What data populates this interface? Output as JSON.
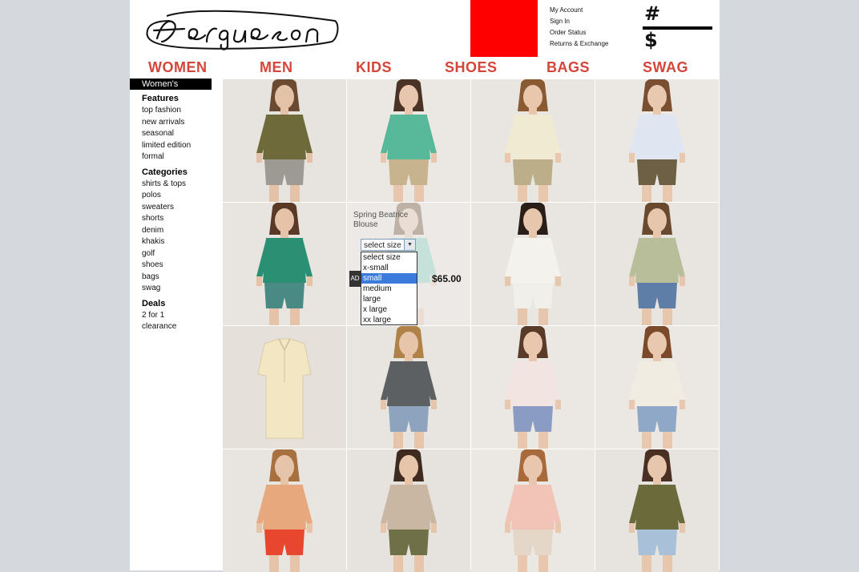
{
  "brand": {
    "logo_text": "Ferguson"
  },
  "account_links": [
    "My Account",
    "Sign In",
    "Order Status",
    "Returns & Exchange"
  ],
  "cart": {
    "count_symbol": "#",
    "total_symbol": "$"
  },
  "nav": [
    "WOMEN",
    "MEN",
    "KIDS",
    "SHOES",
    "BAGS",
    "SWAG"
  ],
  "sidebar": {
    "current": "Women's",
    "sections": [
      {
        "heading": "Features",
        "items": [
          "top fashion",
          "new arrivals",
          "seasonal",
          "limited edition",
          "formal"
        ]
      },
      {
        "heading": "Categories",
        "items": [
          "shirts & tops",
          "polos",
          "sweaters",
          "shorts",
          "denim",
          "khakis",
          "golf",
          "shoes",
          "bags",
          "swag"
        ]
      },
      {
        "heading": "Deals",
        "items": [
          "2 for 1",
          "clearance"
        ]
      }
    ]
  },
  "product_detail": {
    "name": "Spring Beatrice Blouse",
    "size_select": {
      "value": "select size",
      "options": [
        "select size",
        "x-small",
        "small",
        "medium",
        "large",
        "x large",
        "xx large"
      ],
      "highlighted": "small"
    },
    "add_label": "AD",
    "price": "$65.00"
  },
  "products": [
    {
      "top": "#6e6a3a",
      "bottom": "#9c9a92",
      "bg": "#e7e4e0",
      "skin": "#e4c2a8",
      "hair": "#6a4a30"
    },
    {
      "top": "#58b89a",
      "bottom": "#c7b48f",
      "bg": "#ebe7e3",
      "skin": "#e8c6ad",
      "hair": "#4a3324"
    },
    {
      "top": "#f1ead3",
      "bottom": "#bcae88",
      "bg": "#e9e5e0",
      "skin": "#e9c7ac",
      "hair": "#8a5a32"
    },
    {
      "top": "#dfe6f2",
      "bottom": "#6e6044",
      "bg": "#ebe8e4",
      "skin": "#e8c9b0",
      "hair": "#7a4e30"
    },
    {
      "top": "#2b8f73",
      "bottom": "#4a8a84",
      "bg": "#e8e5e1",
      "skin": "#e6c3a8",
      "hair": "#5a3a26"
    },
    {
      "top": "#7fd3c4",
      "bottom": "#ece9e6",
      "bg": "#ece9e6",
      "skin": "#e9ccb4",
      "hair": "#6a4a30"
    },
    {
      "top": "#f4f2ed",
      "bottom": "#f0efea",
      "bg": "#e9e6e2",
      "skin": "#e6c6ad",
      "hair": "#2a1e18"
    },
    {
      "top": "#b8bd9a",
      "bottom": "#5e7ea8",
      "bg": "#e8e4df",
      "skin": "#e6c7ae",
      "hair": "#6a4a2e"
    },
    {
      "top": "#f3e6c2",
      "bottom": "#e6dfc6",
      "bg": "#e5e0d9",
      "skin": "#e5e0d9",
      "hair": "#e5e0d9"
    },
    {
      "top": "#5c6063",
      "bottom": "#8ea3bd",
      "bg": "#e8e4df",
      "skin": "#e6c5ab",
      "hair": "#b08248"
    },
    {
      "top": "#f2e4e0",
      "bottom": "#8a9cc4",
      "bg": "#ebe8e4",
      "skin": "#e8c7ae",
      "hair": "#5a3a28"
    },
    {
      "top": "#f1ece2",
      "bottom": "#8fa8c8",
      "bg": "#ebe8e4",
      "skin": "#e8c8af",
      "hair": "#7a4a2a"
    },
    {
      "top": "#e8a87e",
      "bottom": "#e8462e",
      "bg": "#e8e4df",
      "skin": "#e6c4aa",
      "hair": "#a8703e"
    },
    {
      "top": "#c9b7a4",
      "bottom": "#6f7048",
      "bg": "#e6e2dd",
      "skin": "#e6c5ab",
      "hair": "#3e2a1e"
    },
    {
      "top": "#f2c3b7",
      "bottom": "#e4d7c8",
      "bg": "#ebe8e4",
      "skin": "#e8c7ae",
      "hair": "#a86a3a"
    },
    {
      "top": "#6a6a3a",
      "bottom": "#a8c1d8",
      "bg": "#e7e4e0",
      "skin": "#e6c6ac",
      "hair": "#4a3022"
    }
  ]
}
